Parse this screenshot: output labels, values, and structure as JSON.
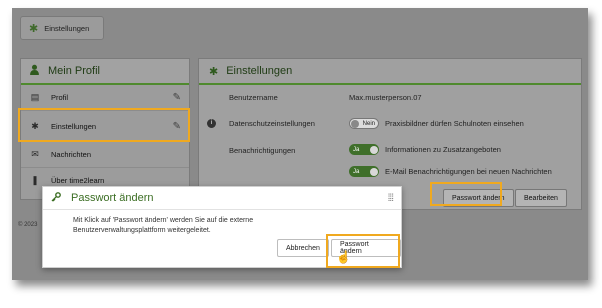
{
  "breadcrumb": {
    "label": "Einstellungen"
  },
  "profile_panel": {
    "title": "Mein Profil",
    "items": [
      {
        "label": "Profil"
      },
      {
        "label": "Einstellungen"
      },
      {
        "label": "Nachrichten"
      },
      {
        "label": "Über time2learn"
      }
    ]
  },
  "settings_panel": {
    "title": "Einstellungen",
    "username_label": "Benutzername",
    "username_value": "Max.musterperson.07",
    "privacy_label": "Datenschutzeinstellungen",
    "privacy_toggle": "Nein",
    "privacy_text": "Praxisbildner dürfen Schulnoten einsehen",
    "notifications_label": "Benachrichtigungen",
    "notif_toggle_1": "Ja",
    "notif_text_1": "Informationen zu Zusatzangeboten",
    "notif_toggle_2": "Ja",
    "notif_text_2": "E-Mail Benachrichtigungen bei neuen Nachrichten",
    "change_password_button": "Passwort ändern",
    "edit_button": "Bearbeiten"
  },
  "footer": {
    "text": "© 2023"
  },
  "dialog": {
    "title": "Passwort ändern",
    "body": "Mit Klick auf 'Passwort ändern' werden Sie auf die externe Benutzerverwaltungsplattform weitergeleitet.",
    "cancel_button": "Abbrechen",
    "confirm_button": "Passwort ändern"
  },
  "colors": {
    "accent": "#4f8a2e",
    "highlight": "#f0a91f",
    "overlay": "#8a8a8a"
  }
}
